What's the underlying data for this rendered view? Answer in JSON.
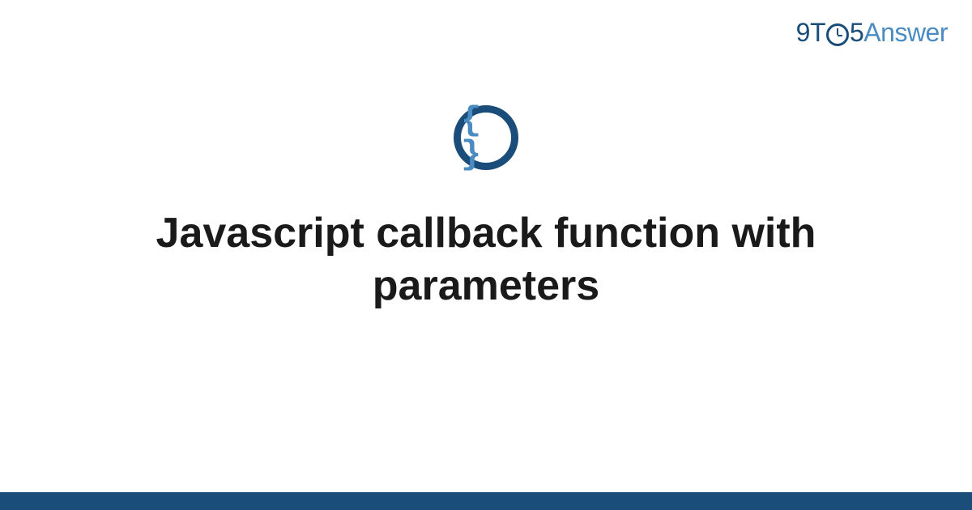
{
  "logo": {
    "prefix_nine": "9",
    "prefix_t": "T",
    "suffix_five": "5",
    "answer": "Answer"
  },
  "icon": {
    "braces": "{ }"
  },
  "title": "Javascript callback function with parameters",
  "colors": {
    "primary_dark": "#1a4d7a",
    "primary_light": "#4a8bc2"
  }
}
